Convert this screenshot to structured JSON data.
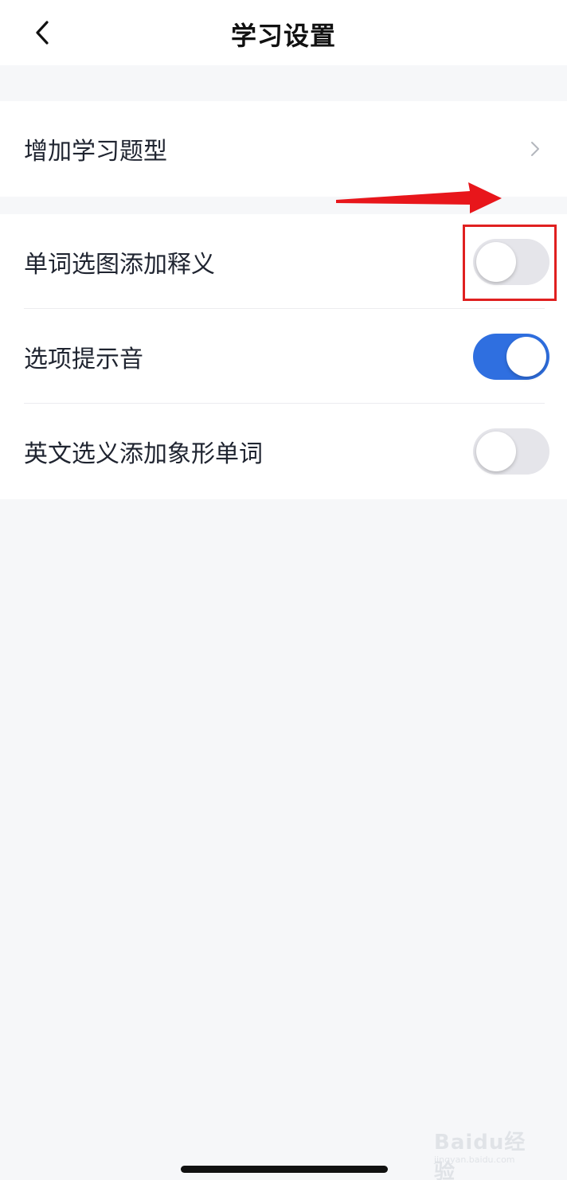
{
  "header": {
    "title": "学习设置",
    "back_icon": "chevron-left-icon"
  },
  "section1": {
    "items": [
      {
        "label": "增加学习题型",
        "type": "link",
        "icon": "chevron-right-icon"
      }
    ]
  },
  "section2": {
    "items": [
      {
        "label": "单词选图添加释义",
        "type": "toggle",
        "enabled": false
      },
      {
        "label": "选项提示音",
        "type": "toggle",
        "enabled": true
      },
      {
        "label": "英文选义添加象形单词",
        "type": "toggle",
        "enabled": false
      }
    ]
  },
  "annotations": {
    "arrow_color": "#e8161b",
    "highlight_color": "#e02020"
  },
  "colors": {
    "toggle_on": "#2f6fe0",
    "toggle_off": "#e5e5ea",
    "page_bg": "#f6f7f9"
  },
  "watermark": {
    "main": "Baidu经验",
    "sub": "jingyan.baidu.com"
  }
}
